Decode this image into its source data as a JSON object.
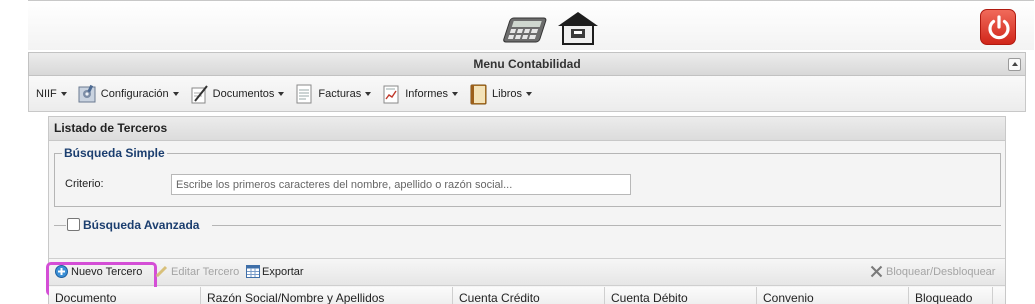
{
  "header": {
    "logo_icon": "calculator-home-icon",
    "power_icon": "power-icon",
    "power_color": "#d9352a"
  },
  "menu": {
    "title": "Menu Contabilidad",
    "items": [
      {
        "label": "NIIF",
        "icon": ""
      },
      {
        "label": "Configuración",
        "icon": "settings-icon"
      },
      {
        "label": "Documentos",
        "icon": "document-edit-icon"
      },
      {
        "label": "Facturas",
        "icon": "invoice-icon"
      },
      {
        "label": "Informes",
        "icon": "report-icon"
      },
      {
        "label": "Libros",
        "icon": "book-icon"
      }
    ]
  },
  "panel": {
    "title": "Listado de Terceros",
    "simple_search": {
      "legend": "Búsqueda Simple",
      "criteria_label": "Criterio:",
      "placeholder": "Escribe los primeros caracteres del nombre, apellido o razón social...",
      "value": ""
    },
    "advanced_search": {
      "label": "Búsqueda Avanzada",
      "checked": false
    },
    "toolbar": {
      "new_label": "Nuevo Tercero",
      "edit_label": "Editar Tercero",
      "export_label": "Exportar",
      "block_label": "Bloquear/Desbloquear"
    },
    "columns": [
      "Documento",
      "Razón Social/Nombre y Apellidos",
      "Cuenta Crédito",
      "Cuenta Débito",
      "Convenio",
      "Bloqueado"
    ]
  },
  "colors": {
    "accent_text": "#1b3e6f",
    "highlight": "#d44ed6"
  }
}
